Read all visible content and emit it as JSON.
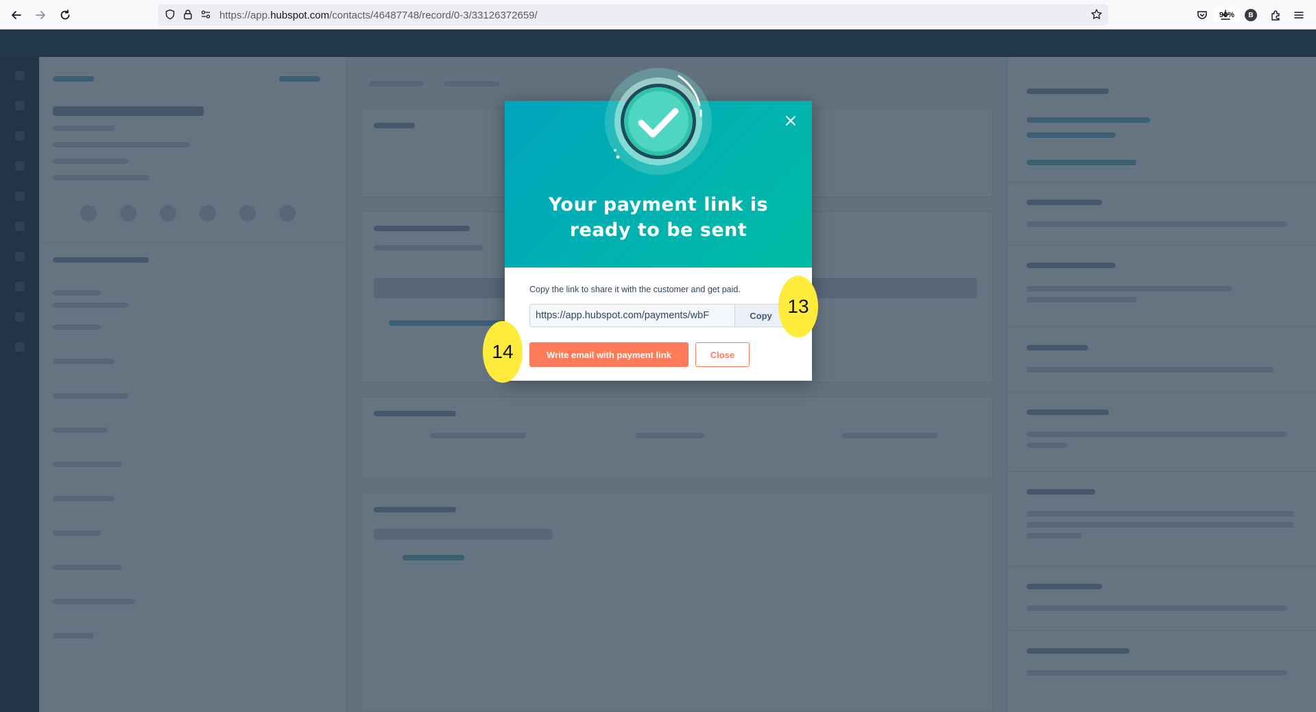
{
  "browser": {
    "url_prefix": "https://app.",
    "url_domain": "hubspot.com",
    "url_path": "/contacts/46487748/record/0-3/33126372659/",
    "zoom": "90%",
    "profile_initial": "B",
    "icons": [
      "back-arrow-icon",
      "forward-arrow-icon",
      "reload-icon",
      "shield-icon",
      "lock-icon",
      "permissions-icon",
      "bookmark-star-icon",
      "pocket-icon",
      "download-icon",
      "extensions-icon",
      "menu-icon"
    ]
  },
  "modal": {
    "title": "Your payment link is ready to be sent",
    "instructions": "Copy the link to share it with the customer and get paid.",
    "link_value": "https://app.hubspot.com/payments/wbF",
    "copy_label": "Copy",
    "primary_label": "Write email with payment link",
    "secondary_label": "Close",
    "icons": [
      "success-check-icon",
      "close-icon"
    ]
  },
  "callouts": {
    "step_a": "13",
    "step_b": "14"
  },
  "colors": {
    "header_gradient_start": "#00a4bd",
    "header_gradient_end": "#00bda5",
    "primary_button": "#ff7a59",
    "callout": "#ffeb3b",
    "overlay": "#1e3044"
  }
}
